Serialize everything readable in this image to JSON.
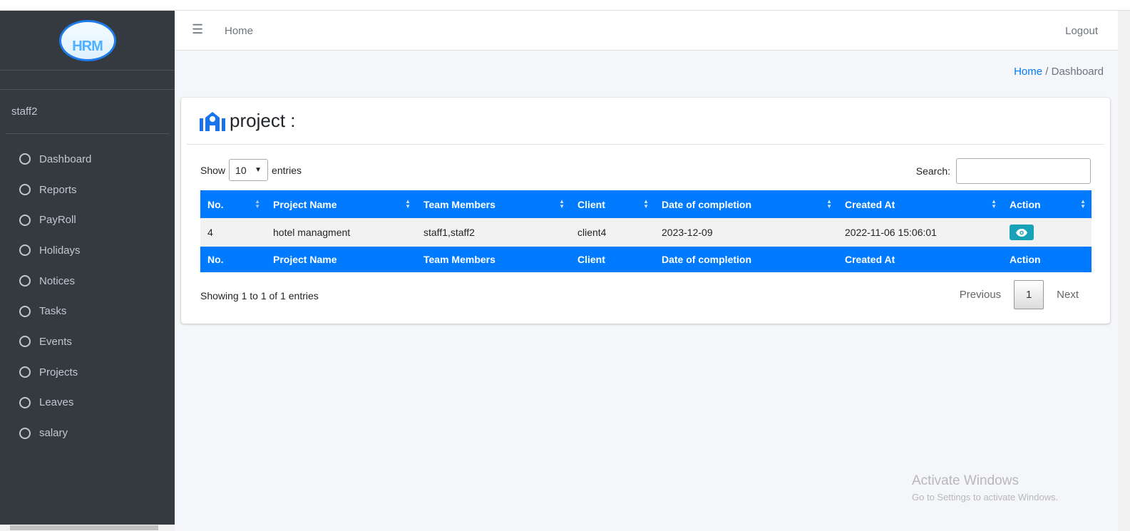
{
  "sidebar": {
    "logo_text": "HRM",
    "user": "staff2",
    "items": [
      {
        "label": "Dashboard"
      },
      {
        "label": "Reports"
      },
      {
        "label": "PayRoll"
      },
      {
        "label": "Holidays"
      },
      {
        "label": "Notices"
      },
      {
        "label": "Tasks"
      },
      {
        "label": "Events"
      },
      {
        "label": "Projects"
      },
      {
        "label": "Leaves"
      },
      {
        "label": "salary"
      }
    ]
  },
  "navbar": {
    "home": "Home",
    "logout": "Logout"
  },
  "breadcrumb": {
    "home": "Home",
    "sep": "/",
    "current": "Dashboard"
  },
  "card": {
    "title": "project :",
    "show_label": "Show",
    "entries_value": "10",
    "entries_label": "entries",
    "search_label": "Search:",
    "search_value": ""
  },
  "table": {
    "columns": [
      "No.",
      "Project Name",
      "Team Members",
      "Client",
      "Date of completion",
      "Created At",
      "Action"
    ],
    "rows": [
      {
        "no": "4",
        "project_name": "hotel managment",
        "team_members": "staff1,staff2",
        "client": "client4",
        "date_of_completion": "2023-12-09",
        "created_at": "2022-11-06 15:06:01"
      }
    ]
  },
  "footer": {
    "info": "Showing 1 to 1 of 1 entries",
    "previous": "Previous",
    "page": "1",
    "next": "Next"
  },
  "watermark": {
    "title": "Activate Windows",
    "subtitle": "Go to Settings to activate Windows."
  },
  "colors": {
    "primary": "#007bff",
    "sidebar": "#343a40",
    "action": "#17a2b8"
  }
}
